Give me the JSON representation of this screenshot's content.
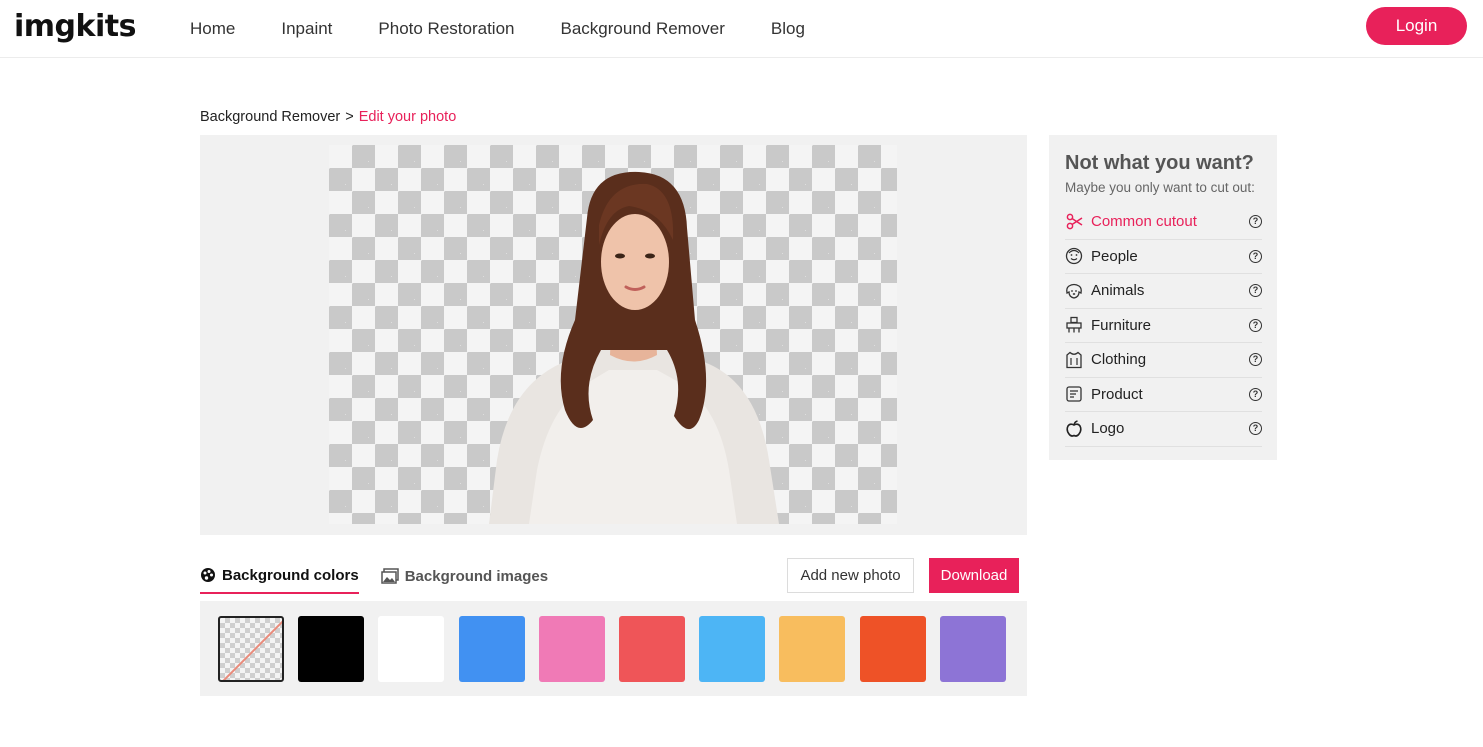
{
  "header": {
    "logo": "imgkits",
    "nav": [
      "Home",
      "Inpaint",
      "Photo Restoration",
      "Background Remover",
      "Blog"
    ],
    "login_label": "Login"
  },
  "breadcrumb": {
    "parent": "Background Remover",
    "separator": ">",
    "current": "Edit your photo"
  },
  "tabs": {
    "colors_label": "Background colors",
    "images_label": "Background images"
  },
  "actions": {
    "add_label": "Add new photo",
    "download_label": "Download"
  },
  "swatches": [
    "transparent",
    "#000000",
    "#ffffff",
    "#4191f2",
    "#f07ab6",
    "#ef5558",
    "#4db5f5",
    "#f8bd5e",
    "#ee5227",
    "#8d74d6"
  ],
  "panel": {
    "title": "Not what you want?",
    "subtitle": "Maybe you only want to cut out:",
    "options": [
      {
        "label": "Common cutout",
        "icon": "scissors-icon"
      },
      {
        "label": "People",
        "icon": "face-icon"
      },
      {
        "label": "Animals",
        "icon": "dog-icon"
      },
      {
        "label": "Furniture",
        "icon": "furniture-icon"
      },
      {
        "label": "Clothing",
        "icon": "clothing-icon"
      },
      {
        "label": "Product",
        "icon": "product-icon"
      },
      {
        "label": "Logo",
        "icon": "apple-icon"
      }
    ],
    "help_symbol": "?"
  },
  "colors": {
    "accent": "#e8215a"
  }
}
